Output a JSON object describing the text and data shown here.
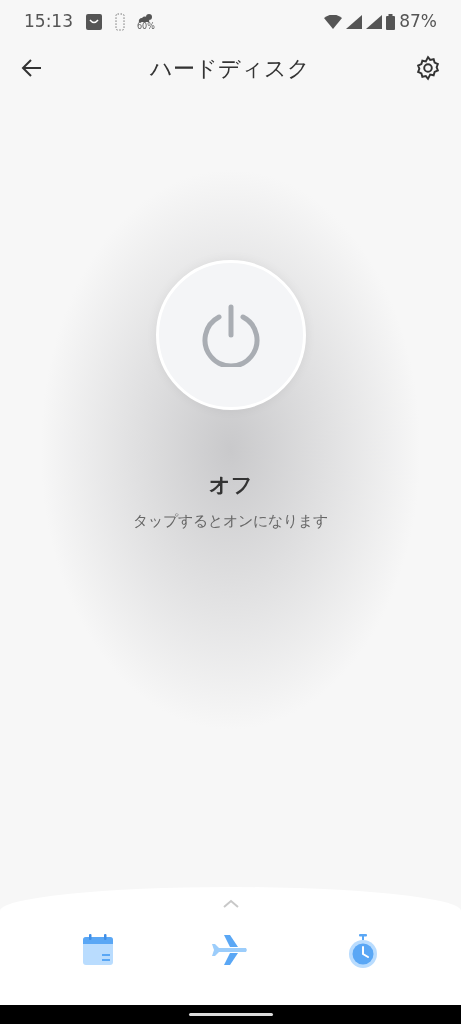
{
  "status_bar": {
    "time": "15:13",
    "weather_reading": "60%",
    "battery": "87%"
  },
  "header": {
    "title": "ハードディスク"
  },
  "power": {
    "on": false,
    "state_label": "オフ",
    "hint": "タップするとオンになります"
  },
  "bottom_tabs": [
    {
      "kind": "calendar"
    },
    {
      "kind": "plane"
    },
    {
      "kind": "timer"
    }
  ]
}
